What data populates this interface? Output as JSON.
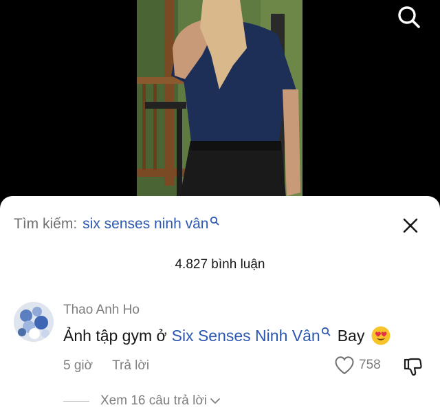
{
  "video": {
    "alt": "video frame"
  },
  "search_bar": {
    "label": "Tìm kiếm:",
    "term": "six senses ninh vân"
  },
  "comments_header": {
    "count_text": "4.827 bình luận"
  },
  "comment": {
    "username": "Thao Anh Ho",
    "text_before": "Ảnh tập gym ở",
    "link_text": "Six Senses Ninh Vân",
    "text_after": "Bay",
    "emoji": "heart-eyes-emoji",
    "time": "5 giờ",
    "reply_label": "Trả lời",
    "like_count": "758"
  },
  "view_replies": {
    "label": "Xem 16 câu trả lời"
  },
  "colors": {
    "link": "#2b57b0",
    "muted": "#7d7d7d",
    "sheet_bg": "#ffffff",
    "backdrop": "#000000"
  }
}
